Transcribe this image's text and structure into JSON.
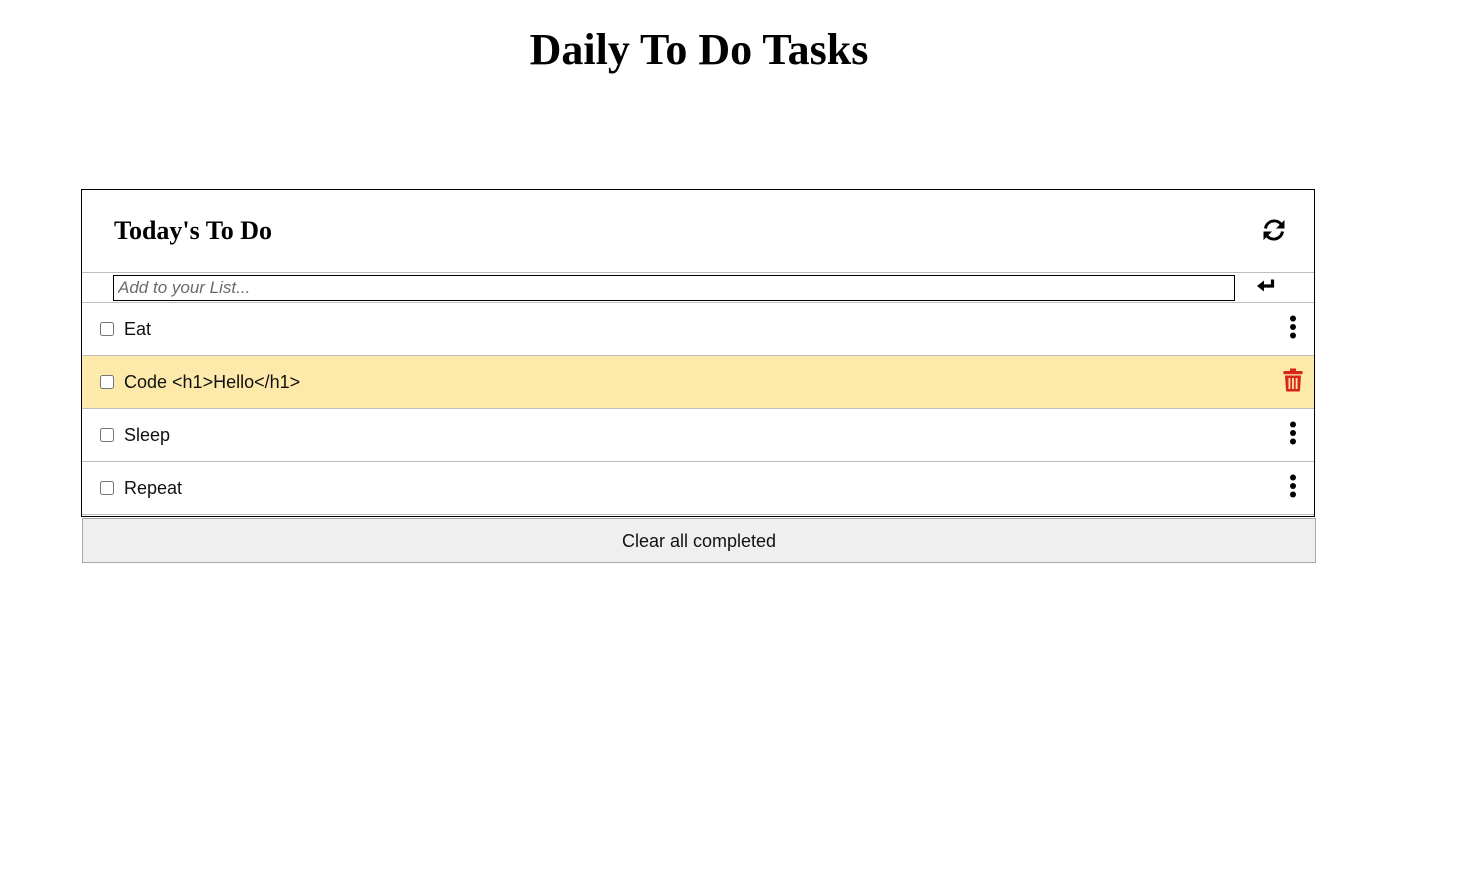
{
  "page": {
    "title": "Daily To Do Tasks"
  },
  "card": {
    "title": "Today's To Do",
    "refresh_icon": "refresh-icon"
  },
  "add_form": {
    "placeholder": "Add to your List...",
    "value": "",
    "submit_icon": "enter-arrow-icon"
  },
  "todos": [
    {
      "label": "Eat",
      "checked": false,
      "action_icon": "vertical-ellipsis-icon"
    },
    {
      "label": "Code <h1>Hello</h1>",
      "checked": false,
      "action_icon": "trash-icon",
      "editing": true
    },
    {
      "label": "Sleep",
      "checked": false,
      "action_icon": "vertical-ellipsis-icon"
    },
    {
      "label": "Repeat",
      "checked": false,
      "action_icon": "vertical-ellipsis-icon"
    }
  ],
  "footer": {
    "clear_label": "Clear all completed"
  },
  "colors": {
    "highlight_row": "#fde9aa",
    "trash_icon": "#d9261c",
    "button_bg": "#efefef"
  }
}
